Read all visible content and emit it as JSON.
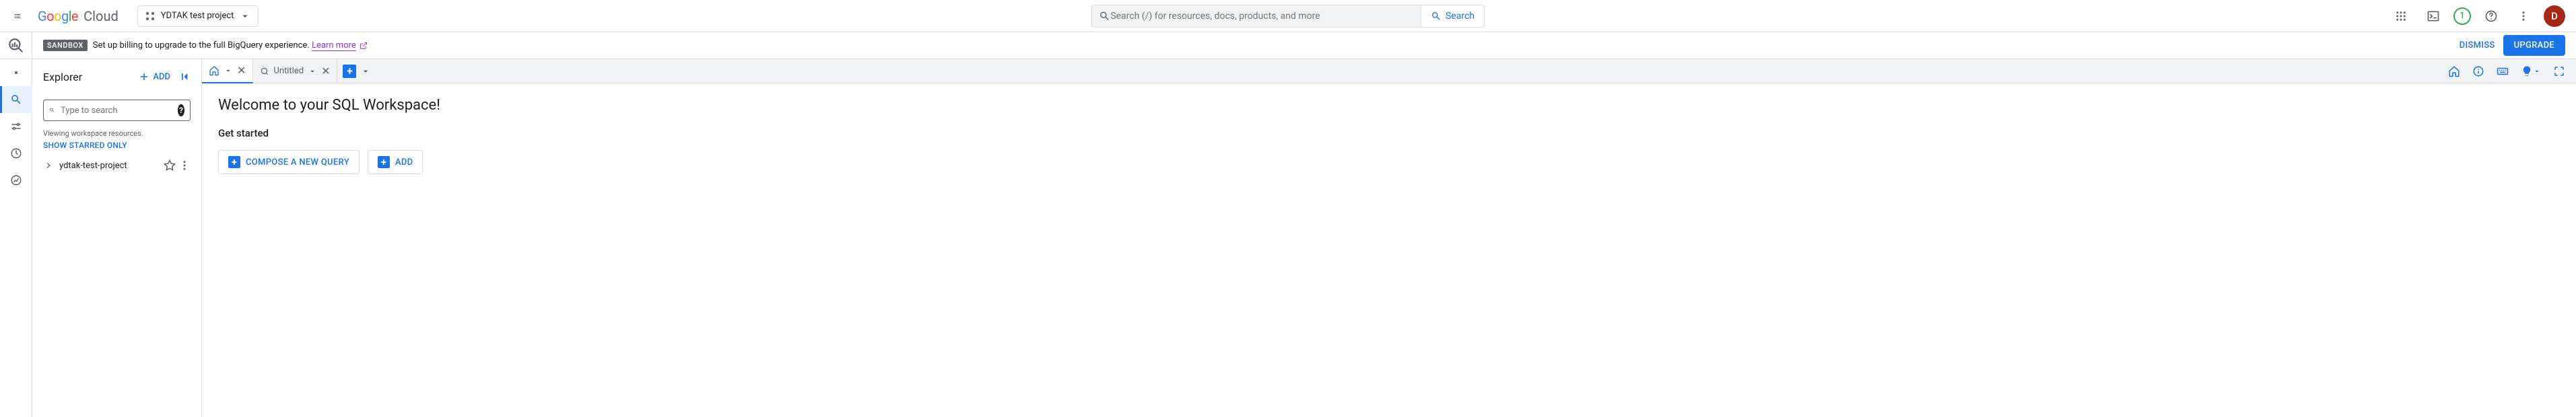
{
  "header": {
    "cloud_word": "Cloud",
    "project_name": "YDTAK test project",
    "search_placeholder": "Search (/) for resources, docs, products, and more",
    "search_button": "Search",
    "trial_number": "1",
    "avatar_letter": "D"
  },
  "banner": {
    "tag": "SANDBOX",
    "message": "Set up billing to upgrade to the full BigQuery experience. ",
    "link_text": "Learn more",
    "dismiss": "DISMISS",
    "upgrade": "UPGRADE"
  },
  "explorer": {
    "title": "Explorer",
    "add_label": "ADD",
    "search_placeholder": "Type to search",
    "viewing_text": "Viewing workspace resources.",
    "show_starred": "SHOW STARRED ONLY",
    "project_item": "ydtak-test-project"
  },
  "tabs": {
    "untitled_label": "Untitled"
  },
  "workspace": {
    "welcome_title": "Welcome to your SQL Workspace!",
    "get_started": "Get started",
    "compose_label": "COMPOSE A NEW QUERY",
    "add_label": "ADD"
  }
}
